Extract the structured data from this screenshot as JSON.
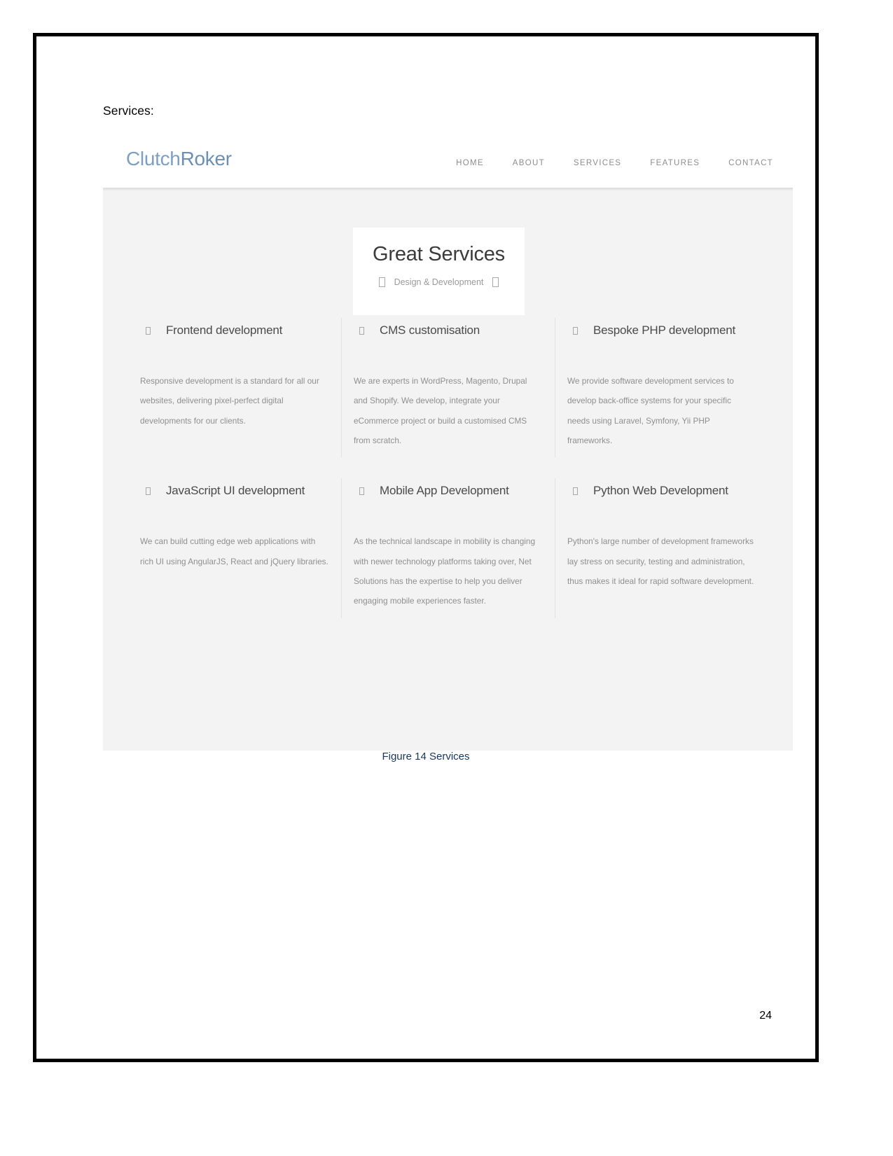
{
  "document": {
    "section_heading": "Services:",
    "figure_caption": "Figure 14 Services",
    "page_number": "24",
    "caption_color": "#17365d"
  },
  "screenshot": {
    "brand": {
      "part1": "Clutch",
      "part2": "Roker",
      "color": "#7d9fc2"
    },
    "nav": {
      "items": [
        {
          "label": "HOME"
        },
        {
          "label": "ABOUT"
        },
        {
          "label": "SERVICES"
        },
        {
          "label": "FEATURES"
        },
        {
          "label": "CONTACT"
        }
      ]
    },
    "hero": {
      "title": "Great Services",
      "subtitle": "Design & Development",
      "left_icon": "missing-glyph-box-icon",
      "right_icon": "missing-glyph-box-icon"
    },
    "services": [
      {
        "icon": "missing-glyph-box-icon",
        "title": "Frontend development",
        "description": "Responsive development is a standard for all our websites, delivering pixel-perfect digital developments for our clients."
      },
      {
        "icon": "missing-glyph-box-icon",
        "title": "CMS customisation",
        "description": "We are experts in WordPress, Magento, Drupal and Shopify. We develop, integrate your eCommerce project or build a customised CMS from scratch."
      },
      {
        "icon": "missing-glyph-box-icon",
        "title": "Bespoke PHP development",
        "description": "We provide software development services to develop back-office systems for your specific needs using Laravel, Symfony, Yii PHP frameworks."
      },
      {
        "icon": "missing-glyph-box-icon",
        "title": "JavaScript UI development",
        "description": "We can build cutting edge web applications with rich UI using AngularJS, React and jQuery libraries."
      },
      {
        "icon": "missing-glyph-box-icon",
        "title": "Mobile App Development",
        "description": "As the technical landscape in mobility is changing with newer technology platforms taking over, Net Solutions has the expertise to help you deliver engaging mobile experiences faster."
      },
      {
        "icon": "missing-glyph-box-icon",
        "title": "Python Web Development",
        "description": "Python's large number of development frameworks lay stress on security, testing and administration, thus makes it ideal for rapid software development."
      }
    ]
  }
}
